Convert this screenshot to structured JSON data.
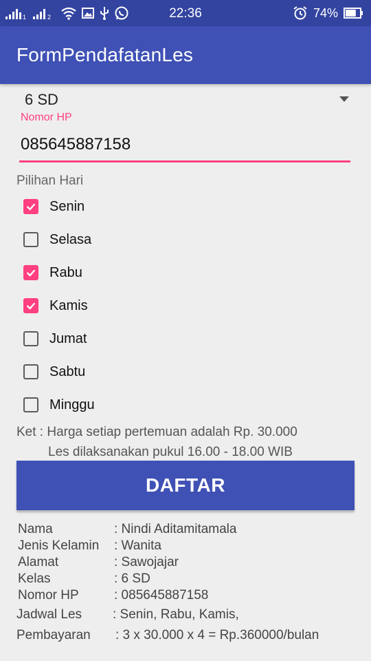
{
  "status_bar": {
    "time": "22:36",
    "battery_percent": "74%",
    "icons": [
      "signal-icon",
      "signal-2-icon",
      "wifi-icon",
      "image-icon",
      "usb-icon",
      "whatsapp-icon",
      "alarm-icon",
      "battery-icon"
    ],
    "battery_level": 0.74
  },
  "app": {
    "title": "FormPendafatanLes"
  },
  "form": {
    "kelas_value": "6 SD",
    "phone_label": "Nomor HP",
    "phone_value": "085645887158",
    "days_label": "Pilihan Hari",
    "days": [
      {
        "label": "Senin",
        "checked": true
      },
      {
        "label": "Selasa",
        "checked": false
      },
      {
        "label": "Rabu",
        "checked": true
      },
      {
        "label": "Kamis",
        "checked": true
      },
      {
        "label": "Jumat",
        "checked": false
      },
      {
        "label": "Sabtu",
        "checked": false
      },
      {
        "label": "Minggu",
        "checked": false
      }
    ],
    "note_line1": "Ket : Harga setiap pertemuan adalah Rp. 30.000",
    "note_line2": "Les dilaksanakan pukul 16.00 - 18.00 WIB",
    "submit_label": "DAFTAR"
  },
  "result": {
    "nama_label": "Nama",
    "nama_value": ": Nindi Aditamitamala",
    "jk_label": "Jenis Kelamin",
    "jk_value": ": Wanita",
    "alamat_label": "Alamat",
    "alamat_value": ": Sawojajar",
    "kelas_label": "Kelas",
    "kelas_value": ": 6 SD",
    "hp_label": "Nomor HP",
    "hp_value": ": 085645887158",
    "jadwal_label": "Jadwal Les",
    "jadwal_value": ": Senin, Rabu, Kamis,",
    "bayar_label": "Pembayaran",
    "bayar_value": ": 3 x 30.000 x 4  = Rp.360000/bulan"
  },
  "colors": {
    "primary": "#3f51b5",
    "primary_dark": "#3344a0",
    "accent": "#ff4081",
    "background": "#eeeeee"
  }
}
